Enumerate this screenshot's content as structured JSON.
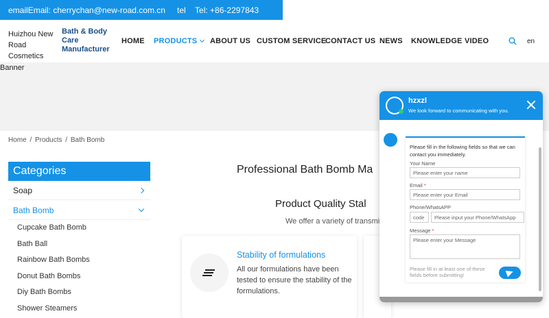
{
  "topbar": {
    "email_label": "email",
    "email_value": "Email: cherrychan@new-road.com.cn",
    "tel_label": "tel",
    "tel_value": "Tel: +86-2297843"
  },
  "header": {
    "company": "Huizhou New Road Cosmetics Company Ltd",
    "tagline": "Bath & Body Care Manufacturer",
    "nav": [
      "HOME",
      "PRODUCTS",
      "ABOUT US",
      "CUSTOM SERVICE",
      "CONTACT US",
      "NEWS",
      "KNOWLEDGE",
      "VIDEO"
    ],
    "lang": "en"
  },
  "banner": {
    "alt": "Banner"
  },
  "breadcrumb": [
    "Home",
    "/",
    "Products",
    "/",
    "Bath Bomb"
  ],
  "sidebar": {
    "title": "Categories",
    "items": [
      "Soap",
      "Bath Bomb"
    ],
    "sub": [
      "Cupcake Bath Bomb",
      "Bath Ball",
      "Rainbow Bath Bombs",
      "Donut Bath Bombs",
      "Diy Bath Bombs",
      "Shower Steamers"
    ]
  },
  "main": {
    "title": "Professional Bath Bomb Ma",
    "quality_title": "Product Quality Stal",
    "quality_sub": "We offer a variety of transmis",
    "card_title": "Stability of formulations",
    "card_text": "All our formulations have been tested to ensure the stability of the formulations."
  },
  "chat": {
    "name": "hzxzl",
    "subtitle": "We look forward to communicating with you.",
    "intro": "Please fill in the following fields so that we can contact you immediately.",
    "name_label": "Your Name",
    "name_placeholder": "Please enter your name",
    "email_label": "Email",
    "email_placeholder": "Please enter your Email",
    "phone_label": "Phone/WhatsAPP",
    "code_placeholder": "code",
    "phone_placeholder": "Please input your Phone/WhatsApp",
    "message_label": "Message",
    "message_placeholder": "Please enter your Message",
    "hint": "Please fill in at least one of these fields before submitting!",
    "required": "*"
  },
  "colors": {
    "accent": "#1592e6"
  }
}
